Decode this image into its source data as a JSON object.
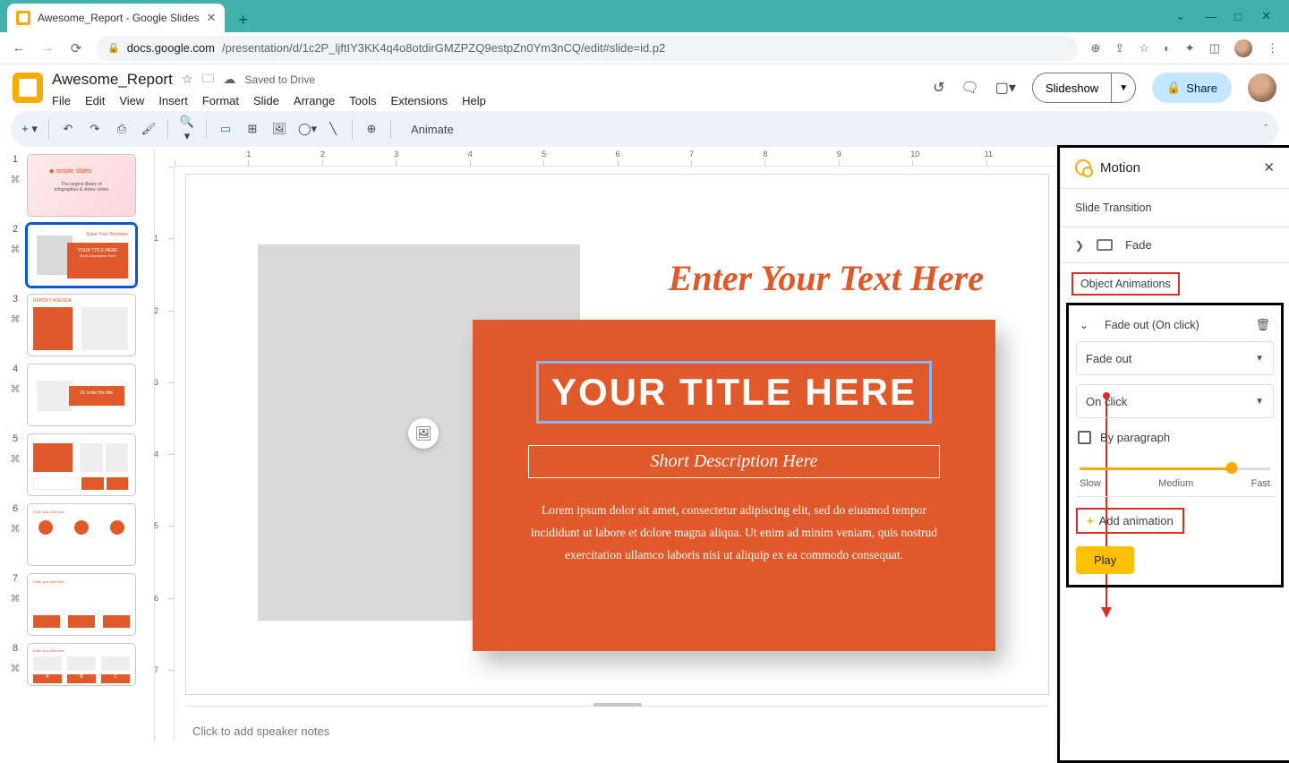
{
  "browser": {
    "tab_title": "Awesome_Report - Google Slides",
    "url_domain": "docs.google.com",
    "url_path": "/presentation/d/1c2P_ljftIY3KK4q4o8otdirGMZPZQ9estpZn0Ym3nCQ/edit#slide=id.p2"
  },
  "app": {
    "doc_title": "Awesome_Report",
    "saved_label": "Saved to Drive",
    "menus": [
      "File",
      "Edit",
      "View",
      "Insert",
      "Format",
      "Slide",
      "Arrange",
      "Tools",
      "Extensions",
      "Help"
    ],
    "slideshow_label": "Slideshow",
    "share_label": "Share"
  },
  "toolbar": {
    "animate_label": "Animate"
  },
  "ruler": {
    "h": [
      "",
      "1",
      "2",
      "3",
      "4",
      "5",
      "6",
      "7",
      "8",
      "9",
      "10",
      "11"
    ],
    "v": [
      "",
      "1",
      "2",
      "3",
      "4",
      "5",
      "6",
      "7"
    ]
  },
  "slide": {
    "heading": "Enter Your Text Here",
    "title": "YOUR TITLE HERE",
    "subtitle": "Short Description Here",
    "body": "Lorem ipsum dolor sit amet, consectetur adipiscing elit, sed do eiusmod tempor incididunt ut labore et dolore magna aliqua. Ut enim ad minim veniam, quis nostrud exercitation ullamco laboris nisi ut aliquip ex ea commodo consequat."
  },
  "notes": {
    "placeholder": "Click to add speaker notes"
  },
  "motion": {
    "panel_title": "Motion",
    "section_transition": "Slide Transition",
    "transition_value": "Fade",
    "section_object": "Object Animations",
    "anim_summary": "Fade out  (On click)",
    "anim_type": "Fade out",
    "anim_trigger": "On click",
    "by_paragraph": "By paragraph",
    "speed": {
      "slow": "Slow",
      "medium": "Medium",
      "fast": "Fast"
    },
    "add_label": "Add animation",
    "play_label": "Play"
  },
  "thumbs": [
    {
      "n": "1"
    },
    {
      "n": "2"
    },
    {
      "n": "3"
    },
    {
      "n": "4"
    },
    {
      "n": "5"
    },
    {
      "n": "6"
    },
    {
      "n": "7"
    },
    {
      "n": "8"
    }
  ]
}
